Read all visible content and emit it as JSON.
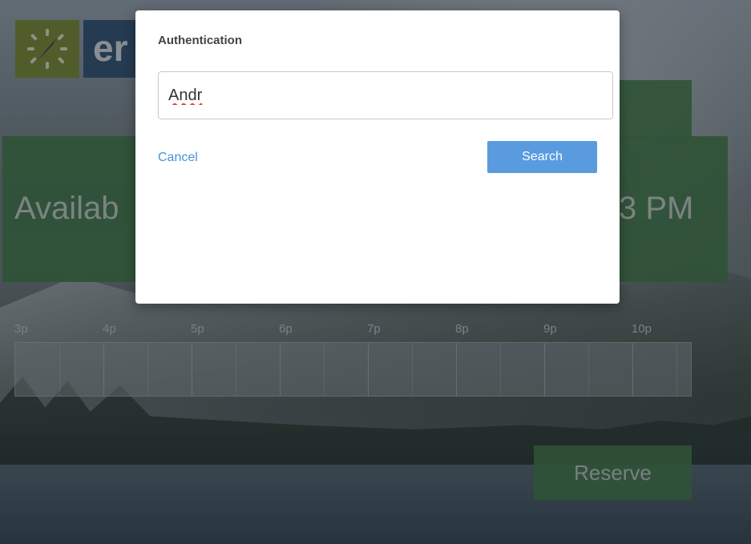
{
  "background": {
    "logo_text": "er",
    "availability_text": "Availab",
    "time_text": "3 PM",
    "hour_labels": [
      "3p",
      "4p",
      "5p",
      "6p",
      "7p",
      "8p",
      "9p",
      "10p"
    ],
    "reserve_label": "Reserve"
  },
  "modal": {
    "title": "Authentication",
    "input_value": "Andr",
    "cancel_label": "Cancel",
    "search_label": "Search"
  },
  "colors": {
    "accent": "#5a9be0",
    "green": "#3d7a44",
    "logo_green": "#7a8a2e",
    "logo_blue": "#2b4f73"
  }
}
